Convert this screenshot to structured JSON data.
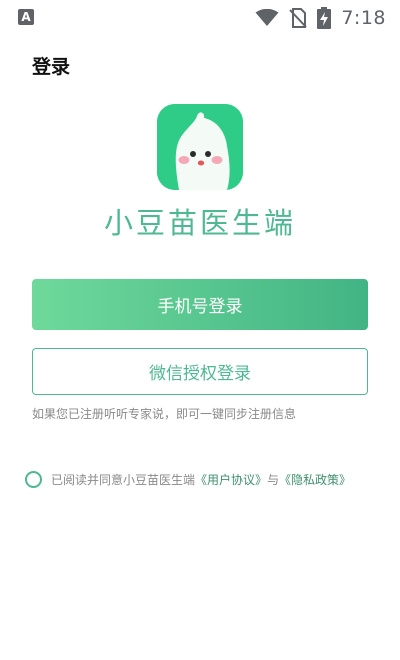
{
  "status_bar": {
    "left_icon_label": "A",
    "time": "7:18",
    "icons": [
      "keyboard-a-icon",
      "wifi-icon",
      "no-sim-icon",
      "battery-charging-icon"
    ]
  },
  "header": {
    "title": "登录"
  },
  "brand": {
    "logo_icon": "ghost-mascot-icon",
    "app_name": "小豆苗医生端",
    "color_primary": "#4fb893",
    "color_logo_bg": "#2ecc87"
  },
  "actions": {
    "phone_login_label": "手机号登录",
    "wechat_login_label": "微信授权登录",
    "hint": "如果您已注册听听专家说，即可一键同步注册信息"
  },
  "agreement": {
    "prefix": "已阅读并同意小豆苗医生端",
    "user_agreement_label": "《用户协议》",
    "conjunction": "与",
    "privacy_policy_label": "《隐私政策》",
    "checked": false
  }
}
